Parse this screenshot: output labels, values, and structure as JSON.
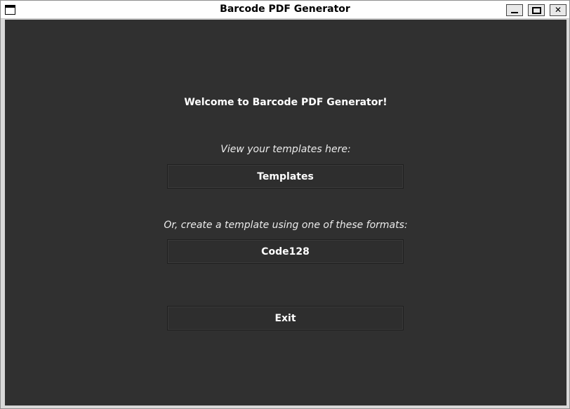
{
  "window": {
    "title": "Barcode PDF Generator",
    "controls": {
      "minimize": "minimize",
      "maximize": "maximize",
      "close": "✕"
    }
  },
  "main": {
    "welcome": "Welcome to Barcode PDF Generator!",
    "templates_hint": "View your templates here:",
    "templates_button": "Templates",
    "formats_hint": "Or, create a template using one of these formats:",
    "formats": [
      "Code128"
    ],
    "exit_button": "Exit"
  },
  "colors": {
    "background": "#303030",
    "text": "#ffffff",
    "button_border": "#1f1f1f"
  }
}
